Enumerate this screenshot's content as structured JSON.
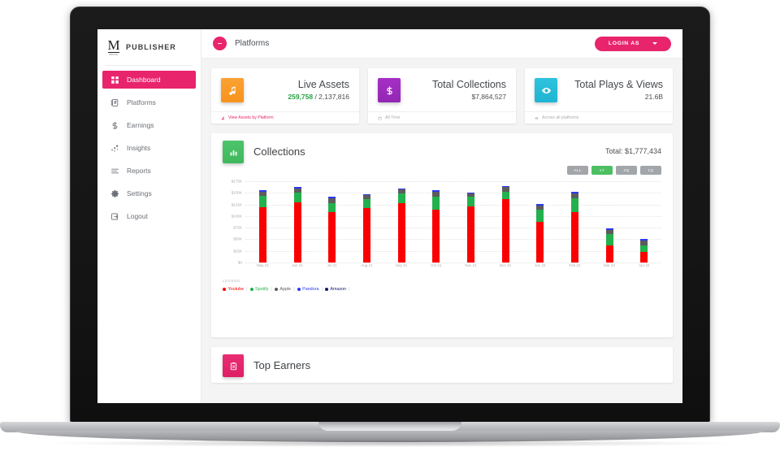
{
  "brand": {
    "mark": "M",
    "mark_sub": "MUSIC",
    "name": "PUBLISHER"
  },
  "sidebar": {
    "items": [
      {
        "label": "Dashboard",
        "icon": "grid-icon",
        "active": true
      },
      {
        "label": "Platforms",
        "icon": "platforms-icon",
        "active": false
      },
      {
        "label": "Earnings",
        "icon": "dollar-icon",
        "active": false
      },
      {
        "label": "Insights",
        "icon": "insights-icon",
        "active": false
      },
      {
        "label": "Reports",
        "icon": "reports-icon",
        "active": false
      },
      {
        "label": "Settings",
        "icon": "gear-icon",
        "active": false
      },
      {
        "label": "Logout",
        "icon": "logout-icon",
        "active": false
      }
    ]
  },
  "topbar": {
    "title": "Platforms",
    "badge_icon": "vertical-dots-icon",
    "login_as_label": "LOGIN AS",
    "caret_icon": "chevron-down-icon"
  },
  "stats": [
    {
      "title": "Live Assets",
      "value_primary": "259,758",
      "value_secondary": " / 2,137,816",
      "icon": "music-note-icon",
      "icon_color": "#f7931e",
      "footer": "View Assets by Platform",
      "footer_icon": "music-note-icon",
      "footer_is_link": true
    },
    {
      "title": "Total Collections",
      "value_primary": "",
      "value_secondary": "$7,864,527",
      "icon": "dollar-icon",
      "icon_color": "#9327b3",
      "footer": "All Time",
      "footer_icon": "calendar-icon",
      "footer_is_link": false
    },
    {
      "title": "Total Plays & Views",
      "value_primary": "",
      "value_secondary": "21.6B",
      "icon": "eye-icon",
      "icon_color": "#1fb5d2",
      "footer": "Across all platforms",
      "footer_icon": "eye-icon",
      "footer_is_link": false
    }
  ],
  "collections": {
    "title": "Collections",
    "icon": "bar-chart-icon",
    "total_label": "Total: $1,777,434",
    "ranges": [
      {
        "label": "ALL",
        "active": false
      },
      {
        "label": "1Y",
        "active": true
      },
      {
        "label": "2Q",
        "active": false
      },
      {
        "label": "1Q",
        "active": false
      }
    ],
    "legend_label": "LEGEND"
  },
  "top_earners": {
    "title": "Top Earners",
    "icon": "clipboard-icon"
  },
  "chart_data": {
    "type": "bar",
    "stacked": true,
    "title": "Collections",
    "xlabel": "",
    "ylabel": "",
    "ylim": [
      0,
      175000
    ],
    "ytick_values": [
      0,
      25000,
      50000,
      75000,
      100000,
      125000,
      150000,
      175000
    ],
    "ytick_labels": [
      "$0",
      "$25K",
      "$50K",
      "$75K",
      "$100K",
      "$125K",
      "$150K",
      "$175K"
    ],
    "grid": true,
    "legend_position": "bottom-left",
    "categories": [
      "May 21",
      "Jun 21",
      "Jul 21",
      "Aug 21",
      "Sep 21",
      "Oct 21",
      "Nov 21",
      "Dec 21",
      "Jan 22",
      "Feb 22",
      "Mar 22",
      "Apr 22"
    ],
    "series": [
      {
        "name": "Youtube",
        "color": "#fb0000",
        "values": [
          119000,
          130000,
          108000,
          118000,
          128000,
          113000,
          121000,
          136000,
          88000,
          108000,
          37000,
          23000
        ]
      },
      {
        "name": "Spotify",
        "color": "#22b14c",
        "values": [
          25000,
          20000,
          20000,
          19000,
          21000,
          29000,
          20000,
          17000,
          26000,
          31000,
          24000,
          14000
        ]
      },
      {
        "name": "Apple",
        "color": "#5c5c5c",
        "values": [
          8000,
          9000,
          11000,
          8000,
          8000,
          10000,
          8000,
          9000,
          9000,
          10000,
          9000,
          10000
        ]
      },
      {
        "name": "Pandora",
        "color": "#2b39f0",
        "values": [
          3000,
          3000,
          2000,
          2000,
          3000,
          3000,
          2000,
          3000,
          3000,
          4000,
          3000,
          3000
        ]
      },
      {
        "name": "Amazon",
        "color": "#161a6b",
        "values": [
          0,
          0,
          0,
          0,
          0,
          0,
          0,
          0,
          0,
          0,
          0,
          0
        ]
      }
    ]
  }
}
